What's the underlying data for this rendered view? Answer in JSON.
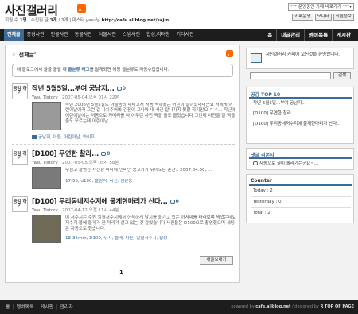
{
  "header": {
    "title": "사진갤러리",
    "info_prefix": "회원 수",
    "info_members": "1명",
    "info_posts_label": "| 수집된 글",
    "info_posts": "3개",
    "info_rest": "/ 3개 | 마스터",
    "info_master": "yasu님",
    "url": "http://cafe.allblog.net/sajin",
    "jump_select": "*** 운영중인 카페 바로가기 ***",
    "buttons": [
      "카페운영",
      "모니터",
      "회원정보"
    ]
  },
  "nav": {
    "items": [
      "전체글",
      "풍경사진",
      "인물사진",
      "동물사진",
      "식물사진",
      "스냅사진",
      "합성,리터칭",
      "기타사진"
    ],
    "right": [
      "홈",
      "내글관리",
      "멤버목록",
      "게시판"
    ]
  },
  "main": {
    "section_title": "'전체글'",
    "notice_prefix": "내 블로그에서 글을 올릴 때",
    "notice_tag": "글분류 태그",
    "notice_suffix": "를 달게되면 해당 글분류로 자동수집됩니다.",
    "posts": [
      {
        "avatar": "공감\n하기",
        "title": "작년 5월5일...부여 궁남지...",
        "comments": "0",
        "author": "Yasu Tistory",
        "date": "2007-05-04 오후 01시 22분",
        "text": "작년 2006년 5월5일로 아들놈의 데리고서 처음 찍어봤는 어린이 날이었다더군요 저에게 어린이날이라 그런 걸 사치주어봐 건진이 그나마 내 사진 잘나가지 못할 하지만요 ^ ^... 작년에 어린이날에는 처음으로 카메라를 사 아무런 사진 찍을 줄도 몰랐습니다 그런데 사진을 잘 찍을 줄도 모르는데 어린이날...",
        "tags": "궁남지, 아들, 어린이날, 와이프"
      },
      {
        "avatar": "공감\n하기",
        "title": "[D100] 우연한 찰라...",
        "comments": "0",
        "author": "Yasu Tistory",
        "date": "2007-05-05 오후 05시 58분",
        "text": "무심코 촬영한 작천항 바다에 인파만 봉고가가 뒤어오온 순간.. 2007.04.30, ...",
        "text2": "17-55, d100, 올림픽, 사진, 삼은동",
        "tags": ""
      },
      {
        "avatar": "공감\n하기",
        "title": "[D100] 우리동네저수지에 물게한마리가 산다...",
        "comments": "0",
        "author": "Yasu Tistory",
        "date": "2007-04-12 오전 11시 44분",
        "text": "이 저수지는 수원 일월저수지에서 한적하게 낚시를 즐기고 있는 아저씨를 바라보며 찍었는데요 저수지 물에 물게가 한 마리가 살고 있는 것 같았습니다 사진들은 D100으로 촬영했으며 세팅은 자동으로 했습니다.",
        "tags": "18-35mm, D100, 낚시, 물게, 사진, 일월저수지, 합성"
      }
    ],
    "more_button": "내글보내기",
    "page": "1"
  },
  "sidebar": {
    "welcome": "사진갤러리 카페에 오신것을 환영합니다.",
    "search_button": "검색",
    "top10_title": "공감 TOP 10",
    "top10": [
      "작년 5월5일...부여 궁남지...",
      "[D100] 우연한 찰라...",
      "[D100] 우리동네저수지에 물게한마리가 산다..."
    ],
    "comments_title": "댓글 리본자",
    "comment_item": "자동으로 글이 올라가는군요~...",
    "counter_title": "Counter",
    "counter": [
      {
        "label": "Today",
        "value": ": 2"
      },
      {
        "label": "Yesterday",
        "value": ": 0"
      },
      {
        "label": "Total",
        "value": ": 2"
      }
    ]
  },
  "footer": {
    "nav": [
      "홈",
      "멤버목록",
      "게시판",
      "관리자"
    ],
    "credit_prefix": "powered by",
    "credit_site": "cafe.allblog.net",
    "credit_suffix": "/ designed by",
    "credit_designer": "R",
    "top": "TOP OF PAGE"
  }
}
